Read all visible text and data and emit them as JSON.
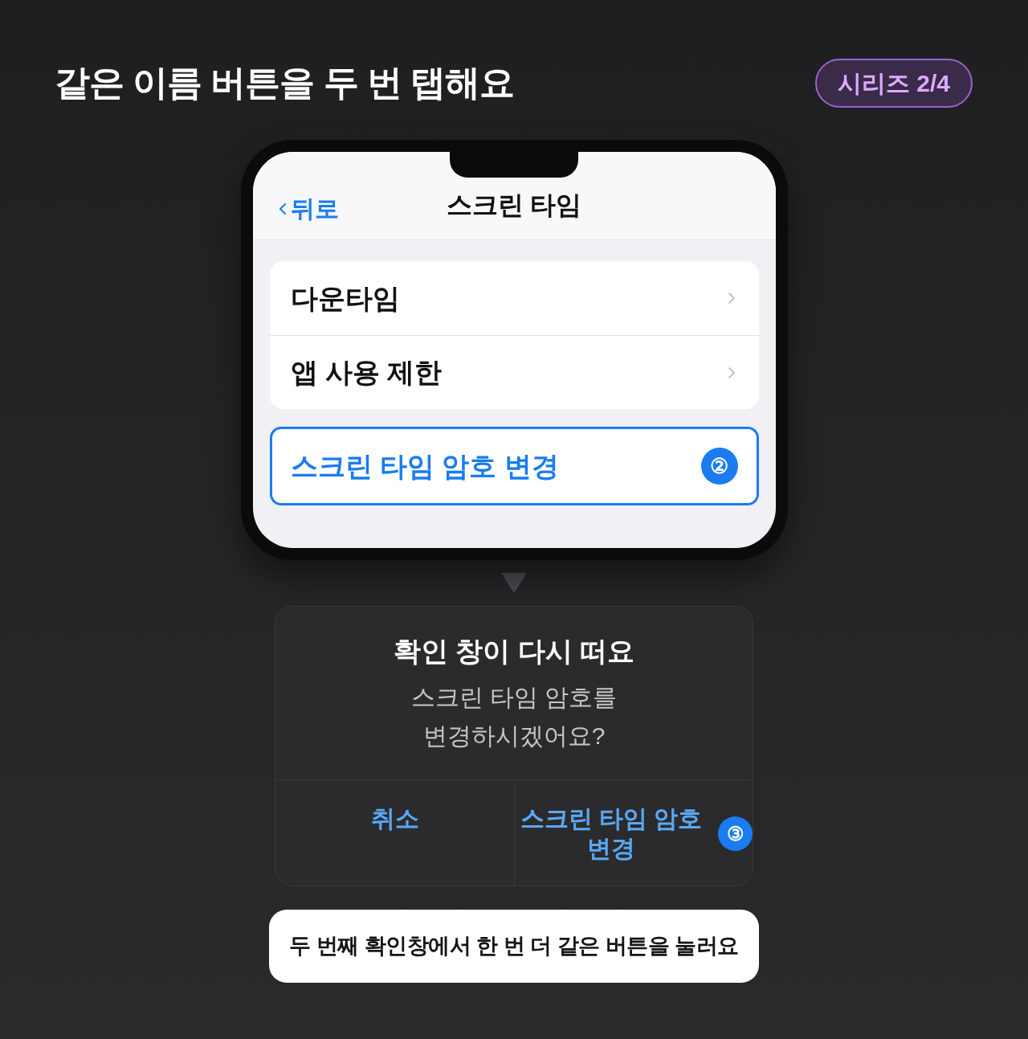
{
  "header": {
    "title": "같은 이름 버튼을 두 번 탭해요",
    "series_badge": "시리즈 2/4"
  },
  "phone": {
    "nav": {
      "back": "뒤로",
      "title": "스크린 타임"
    },
    "groups": [
      {
        "highlighted": false,
        "rows": [
          {
            "kind": "disclosure",
            "label": "다운타임"
          },
          {
            "kind": "disclosure",
            "label": "앱 사용 제한"
          }
        ]
      },
      {
        "highlighted": true,
        "rows": [
          {
            "kind": "action",
            "label": "스크린 타임 암호 변경",
            "step": "②"
          }
        ]
      }
    ]
  },
  "dialog": {
    "title": "확인 창이 다시 떠요",
    "message": "스크린 타임 암호를\n변경하시겠어요?",
    "buttons": [
      {
        "label": "취소"
      },
      {
        "label": "스크린 타임 암호 변경",
        "step": "③"
      }
    ]
  },
  "caption": "두 번째 확인창에서 한 번 더 같은 버튼을 눌러요"
}
